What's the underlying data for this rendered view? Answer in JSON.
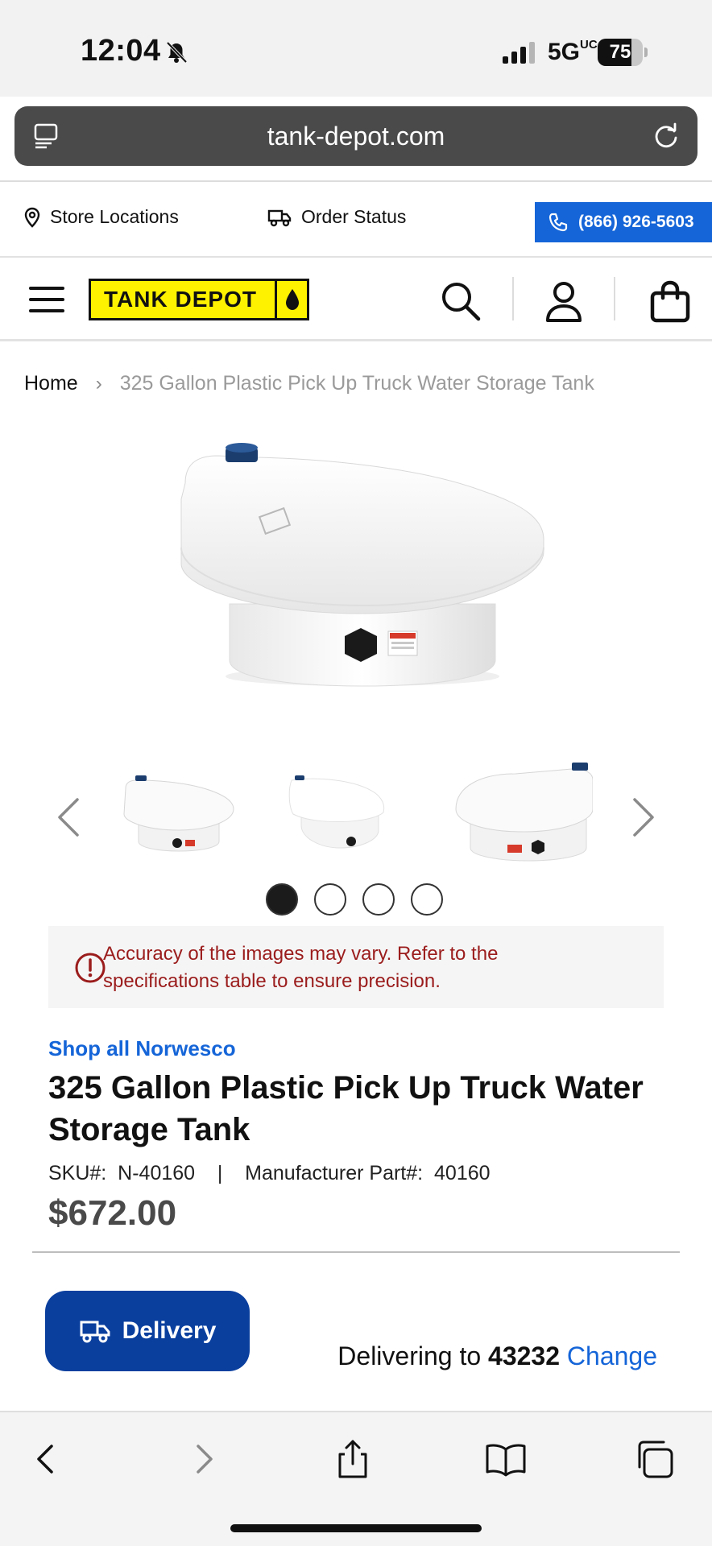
{
  "status_bar": {
    "time": "12:04",
    "network": "5G",
    "network_sup": "UC",
    "battery_level": "75",
    "battery_fraction": 0.75
  },
  "browser": {
    "url": "tank-depot.com"
  },
  "utility_bar": {
    "store_locations": "Store Locations",
    "order_status": "Order Status",
    "phone": "(866) 926-5603"
  },
  "header": {
    "logo_text": "TANK DEPOT"
  },
  "breadcrumb": {
    "home": "Home",
    "separator": "›",
    "current": "325 Gallon Plastic Pick Up Truck Water Storage Tank"
  },
  "gallery": {
    "thumbnail_count": 3,
    "dot_count": 4,
    "active_dot": 0
  },
  "notice": {
    "text": "Accuracy of the images may vary. Refer to the specifications table to ensure precision."
  },
  "product": {
    "brand_link": "Shop all Norwesco",
    "title": "325 Gallon Plastic Pick Up Truck Water Storage Tank",
    "sku_label": "SKU#:",
    "sku": "N-40160",
    "sku_separator": "|",
    "mfr_label": "Manufacturer Part#:",
    "mfr_part": "40160",
    "price": "$672.00"
  },
  "delivery": {
    "button_label": "Delivery",
    "delivering_prefix": "Delivering to",
    "zip": "43232",
    "change_label": "Change"
  },
  "icons": {
    "bell": "bell-slash-icon",
    "search": "search-icon",
    "account": "user-icon",
    "cart": "shopping-bag-icon"
  },
  "colors": {
    "brand_yellow": "#fff200",
    "phone_blue": "#1565d8",
    "delivery_blue": "#0a3f9e",
    "notice_red": "#9b1c1c"
  }
}
